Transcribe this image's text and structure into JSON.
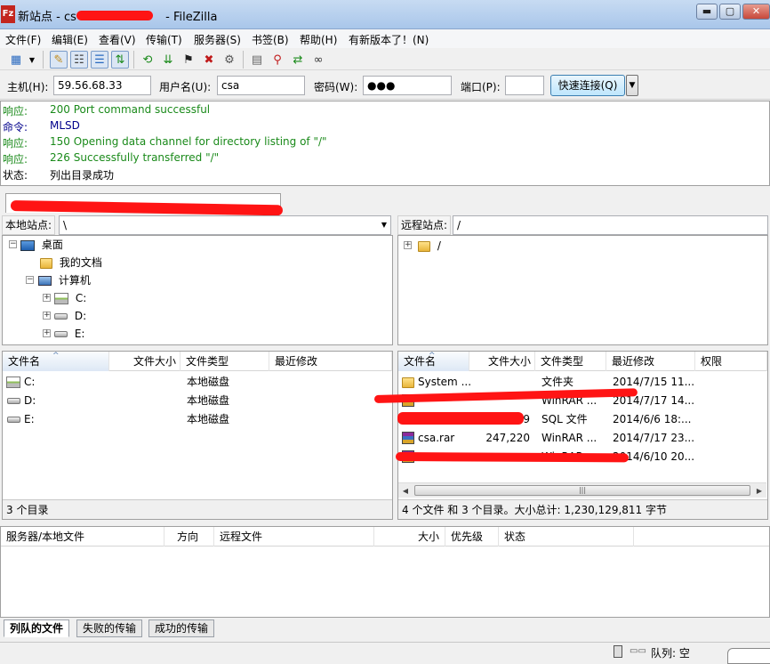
{
  "window": {
    "title_prefix": "新站点 - cs",
    "title_suffix": "- FileZilla",
    "app_icon_glyph": "Fz"
  },
  "menu": [
    "文件(F)",
    "编辑(E)",
    "查看(V)",
    "传输(T)",
    "服务器(S)",
    "书签(B)",
    "帮助(H)",
    "有新版本了！(N)"
  ],
  "toolbar_icons": [
    "site-manager-icon",
    "dropdown-arrow-icon",
    "toggle-log-icon",
    "toggle-local-tree-icon",
    "toggle-remote-tree-icon",
    "toggle-queue-icon",
    "refresh-icon",
    "process-queue-icon",
    "cancel-icon",
    "disconnect-icon",
    "reconnect-icon",
    "directory-compare-icon",
    "filter-icon",
    "sync-browse-icon",
    "search-icon"
  ],
  "quickconnect": {
    "host_label": "主机(H):",
    "host_value": "59.56.68.33",
    "user_label": "用户名(U):",
    "user_value": "csa",
    "pass_label": "密码(W):",
    "pass_value": "●●●",
    "port_label": "端口(P):",
    "port_value": "",
    "connect_button": "快速连接(Q)"
  },
  "log": [
    {
      "type": "响应:",
      "msg": "200 Port command successful",
      "color": "#1a8a1a"
    },
    {
      "type": "命令:",
      "msg": "MLSD",
      "color": "#00008b"
    },
    {
      "type": "响应:",
      "msg": "150 Opening data channel for directory listing of \"/\"",
      "color": "#1a8a1a"
    },
    {
      "type": "响应:",
      "msg": "226 Successfully transferred \"/\"",
      "color": "#1a8a1a"
    },
    {
      "type": "状态:",
      "msg": "列出目录成功",
      "color": "#000000"
    }
  ],
  "local": {
    "site_label": "本地站点:",
    "site_path": "\\",
    "tree": [
      {
        "label": "桌面",
        "icon": "desktop-icon"
      },
      {
        "label": "我的文档",
        "icon": "folder-icon"
      },
      {
        "label": "计算机",
        "icon": "computer-icon"
      },
      {
        "label": "C:",
        "icon": "system-drive-icon"
      },
      {
        "label": "D:",
        "icon": "drive-icon"
      },
      {
        "label": "E:",
        "icon": "drive-icon"
      }
    ],
    "columns": [
      "文件名",
      "文件大小",
      "文件类型",
      "最近修改"
    ],
    "rows": [
      {
        "name": "C:",
        "type": "本地磁盘",
        "icon": "system-drive-icon"
      },
      {
        "name": "D:",
        "type": "本地磁盘",
        "icon": "drive-icon"
      },
      {
        "name": "E:",
        "type": "本地磁盘",
        "icon": "drive-icon"
      }
    ],
    "status": "3 个目录"
  },
  "remote": {
    "site_label": "远程站点:",
    "site_path": "/",
    "tree_root": "/",
    "columns": [
      "文件名",
      "文件大小",
      "文件类型",
      "最近修改",
      "权限"
    ],
    "rows": [
      {
        "name": "System ...",
        "size": "",
        "type": "文件夹",
        "modified": "2014/7/15 11...",
        "icon": "folder-icon"
      },
      {
        "name": "",
        "size": "",
        "type": "WinRAR ...",
        "modified": "2014/7/17 14...",
        "icon": "rar-icon"
      },
      {
        "name": "",
        "size": "69",
        "type": "SQL 文件",
        "modified": "2014/6/6 18:...",
        "icon": "sql-icon"
      },
      {
        "name": "csa.rar",
        "size": "247,220",
        "type": "WinRAR ...",
        "modified": "2014/7/17 23...",
        "icon": "rar-icon"
      },
      {
        "name": "",
        "size": "",
        "type": "WinRAR ...",
        "modified": "2014/6/10 20...",
        "icon": "rar-icon"
      }
    ],
    "status": "4 个文件 和 3 个目录。大小总计: 1,230,129,811 字节"
  },
  "queue": {
    "columns": [
      "服务器/本地文件",
      "方向",
      "远程文件",
      "大小",
      "优先级",
      "状态"
    ],
    "tabs": [
      "列队的文件",
      "失败的传输",
      "成功的传输"
    ]
  },
  "statusbar": {
    "queue_text": "队列: 空"
  },
  "colors": {
    "redaction": "#ff1414",
    "titlebar": "#a9c6ea"
  }
}
